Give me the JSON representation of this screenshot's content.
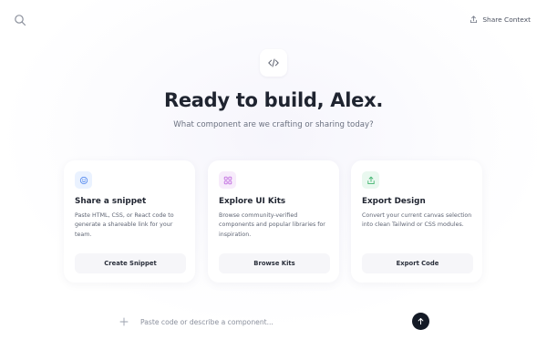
{
  "header": {
    "search_icon": "search-icon",
    "share_label": "Share Context",
    "share_icon": "share-icon"
  },
  "hero": {
    "badge_icon": "code-icon",
    "title": "Ready to build, Alex.",
    "subtitle": "What component are we crafting or sharing today?"
  },
  "cards": [
    {
      "icon": "smile-icon",
      "title": "Share a snippet",
      "description": "Paste HTML, CSS, or React code to generate a shareable link for your team.",
      "button_label": "Create Snippet",
      "accent": "#eaf2ff",
      "icon_color": "#5a8def"
    },
    {
      "icon": "grid-icon",
      "title": "Explore UI Kits",
      "description": "Browse community-verified components and popular libraries for inspiration.",
      "button_label": "Browse Kits",
      "accent": "#f7ecfb",
      "icon_color": "#c26fe0"
    },
    {
      "icon": "share-icon",
      "title": "Export Design",
      "description": "Convert your current canvas selection into clean Tailwind or CSS modules.",
      "button_label": "Export Code",
      "accent": "#e9f8ef",
      "icon_color": "#3fb36d"
    }
  ],
  "composer": {
    "plus_icon": "plus-icon",
    "placeholder": "Paste code or describe a component...",
    "value": "",
    "send_icon": "arrow-up-icon"
  },
  "colors": {
    "title_text": "#1f2430",
    "muted_text": "#6b7180",
    "send_button": "#141a26"
  }
}
